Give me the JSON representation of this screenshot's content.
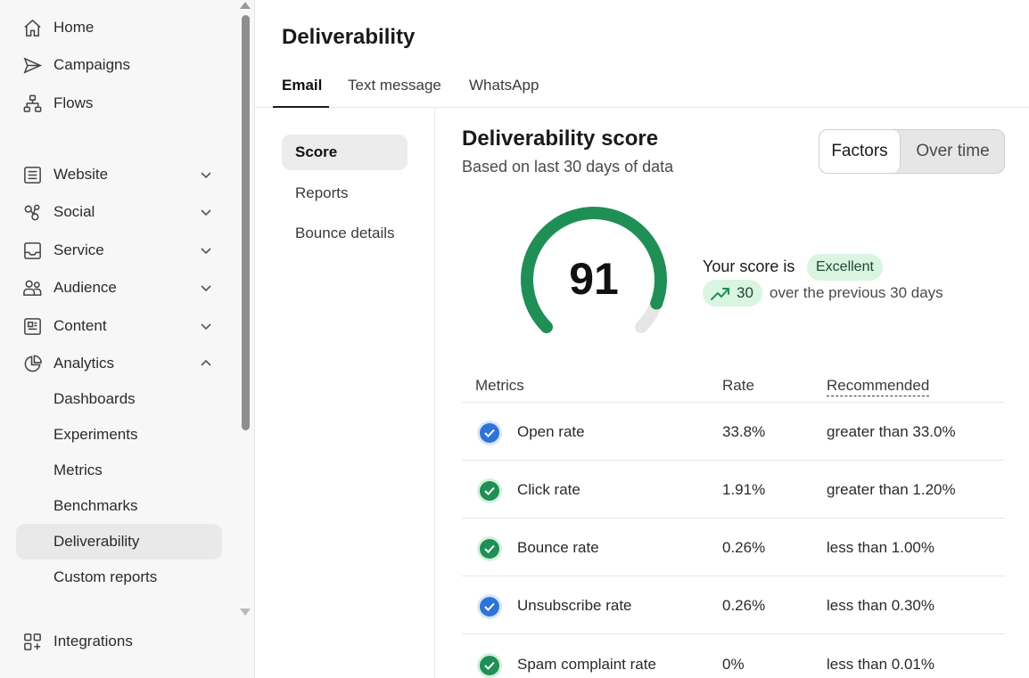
{
  "sidebar": {
    "top_items": [
      {
        "label": "Home",
        "icon": "home-icon"
      },
      {
        "label": "Campaigns",
        "icon": "send-icon"
      },
      {
        "label": "Flows",
        "icon": "flows-icon"
      }
    ],
    "groups": [
      {
        "label": "Website",
        "icon": "website-icon",
        "expanded": false
      },
      {
        "label": "Social",
        "icon": "social-icon",
        "expanded": false
      },
      {
        "label": "Service",
        "icon": "service-icon",
        "expanded": false
      },
      {
        "label": "Audience",
        "icon": "audience-icon",
        "expanded": false
      },
      {
        "label": "Content",
        "icon": "content-icon",
        "expanded": false
      },
      {
        "label": "Analytics",
        "icon": "analytics-icon",
        "expanded": true
      }
    ],
    "analytics_items": [
      "Dashboards",
      "Experiments",
      "Metrics",
      "Benchmarks",
      "Deliverability",
      "Custom reports"
    ],
    "active_item": "Deliverability",
    "bottom_item": {
      "label": "Integrations",
      "icon": "integrations-icon"
    }
  },
  "header": {
    "title": "Deliverability",
    "tabs": [
      "Email",
      "Text message",
      "WhatsApp"
    ],
    "active_tab": "Email"
  },
  "subnav": {
    "items": [
      "Score",
      "Reports",
      "Bounce details"
    ],
    "active": "Score"
  },
  "score": {
    "title": "Deliverability score",
    "subtitle": "Based on last 30 days of data",
    "toggle": [
      "Factors",
      "Over time"
    ],
    "toggle_active": "Factors",
    "value": "91",
    "gauge_fraction": 0.91,
    "your_score_label": "Your score is",
    "rating": "Excellent",
    "change": "30",
    "change_text": "over the previous 30 days"
  },
  "metrics": {
    "headers": {
      "metric": "Metrics",
      "rate": "Rate",
      "recommended": "Recommended"
    },
    "rows": [
      {
        "name": "Open rate",
        "rate": "33.8%",
        "recommended": "greater than 33.0%",
        "status": "blue"
      },
      {
        "name": "Click rate",
        "rate": "1.91%",
        "recommended": "greater than 1.20%",
        "status": "green"
      },
      {
        "name": "Bounce rate",
        "rate": "0.26%",
        "recommended": "less than 1.00%",
        "status": "green"
      },
      {
        "name": "Unsubscribe rate",
        "rate": "0.26%",
        "recommended": "less than 0.30%",
        "status": "blue"
      },
      {
        "name": "Spam complaint rate",
        "rate": "0%",
        "recommended": "less than 0.01%",
        "status": "green"
      }
    ]
  },
  "colors": {
    "gauge_green": "#1f8f55",
    "gauge_track": "#e6e6e6",
    "check_green": "#1f8f55",
    "check_green_ring": "#d3f1dd",
    "check_blue": "#2e74d8",
    "check_blue_ring": "#d9e7fb",
    "badge_bg": "#d9f4e1"
  }
}
